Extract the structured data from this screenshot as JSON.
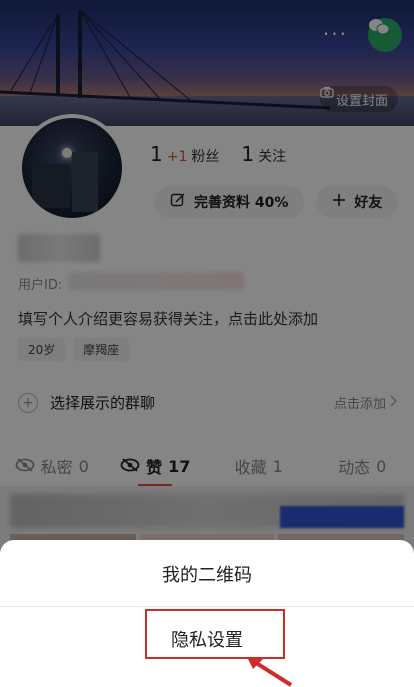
{
  "cover": {
    "set_cover_label": "设置封面",
    "more_label": "···"
  },
  "profile": {
    "followers_count": "1",
    "followers_delta": "+1",
    "followers_label": "粉丝",
    "following_count": "1",
    "following_label": "关注",
    "complete_profile_label": "完善资料 40%",
    "add_friend_label": "好友",
    "uid_label": "用户ID:",
    "bio": "填写个人介绍更容易获得关注，点击此处添加",
    "tags": [
      "20岁",
      "摩羯座"
    ]
  },
  "group": {
    "label": "选择展示的群聊",
    "action": "点击添加"
  },
  "tabs": [
    {
      "label": "私密",
      "count": "0"
    },
    {
      "label": "赞",
      "count": "17"
    },
    {
      "label": "收藏",
      "count": "1"
    },
    {
      "label": "动态",
      "count": "0"
    }
  ],
  "sheet": {
    "qr_label": "我的二维码",
    "privacy_label": "隐私设置"
  },
  "colors": {
    "accent": "#e94b3c",
    "wechat": "#2aae67",
    "highlight": "#d02a2a"
  }
}
